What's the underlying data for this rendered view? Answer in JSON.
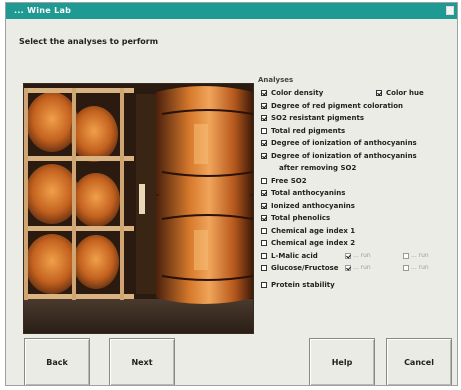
{
  "window": {
    "title": "... Wine Lab",
    "accent_color": "#1f9a93"
  },
  "instruction": "Select the analyses to perform",
  "photo": {
    "icon": "wine-barrels-photo"
  },
  "analyses": {
    "label": "Analyses",
    "items": [
      {
        "label": "Color density",
        "checked": true
      },
      {
        "label": "Degree of red pigment coloration",
        "checked": true
      },
      {
        "label": "SO2 resistant pigments",
        "checked": true
      },
      {
        "label": "Total red pigments",
        "checked": false
      },
      {
        "label": "Degree of ionization of anthocyanins",
        "checked": true
      },
      {
        "label": "Degree of ionization of anthocyanins",
        "checked": true
      },
      {
        "label": "after removing SO2",
        "checked": null
      },
      {
        "label": "Free SO2",
        "checked": false
      },
      {
        "label": "Total anthocyanins",
        "checked": true
      },
      {
        "label": "Ionized anthocyanins",
        "checked": true
      },
      {
        "label": "Total phenolics",
        "checked": true
      },
      {
        "label": "Chemical age index 1",
        "checked": false
      },
      {
        "label": "Chemical age index 2",
        "checked": false
      },
      {
        "label": "L-Malic acid",
        "checked": false
      },
      {
        "label": "Glucose/Fructose",
        "checked": false
      },
      {
        "label": "Protein stability",
        "checked": false
      }
    ],
    "color_hue": {
      "label": "Color hue",
      "checked": true
    },
    "malic_options": [
      "... run",
      "... run"
    ],
    "glucose_options": [
      "... run",
      "... run"
    ]
  },
  "buttons": {
    "back": "Back",
    "next": "Next",
    "help": "Help",
    "cancel": "Cancel"
  }
}
